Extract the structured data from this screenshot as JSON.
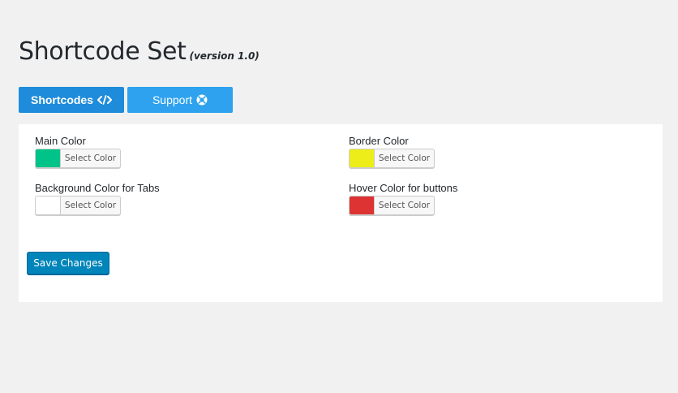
{
  "header": {
    "title": "Shortcode Set",
    "version": "(version 1.0)"
  },
  "tabs": [
    {
      "label": "Shortcodes",
      "icon": "code-icon",
      "active": true,
      "color": "#1e8cda"
    },
    {
      "label": "Support",
      "icon": "support-lifebuoy-icon",
      "active": false,
      "color": "#2ea2ee"
    }
  ],
  "fields": {
    "main_color": {
      "label": "Main Color",
      "value": "#00c389",
      "button": "Select Color"
    },
    "border_color": {
      "label": "Border Color",
      "value": "#eded1a",
      "button": "Select Color"
    },
    "background_tabs": {
      "label": "Background Color for Tabs",
      "value": "#ffffff",
      "button": "Select Color"
    },
    "hover_buttons": {
      "label": "Hover Color for buttons",
      "value": "#dd3333",
      "button": "Select Color"
    }
  },
  "actions": {
    "save_label": "Save Changes"
  }
}
